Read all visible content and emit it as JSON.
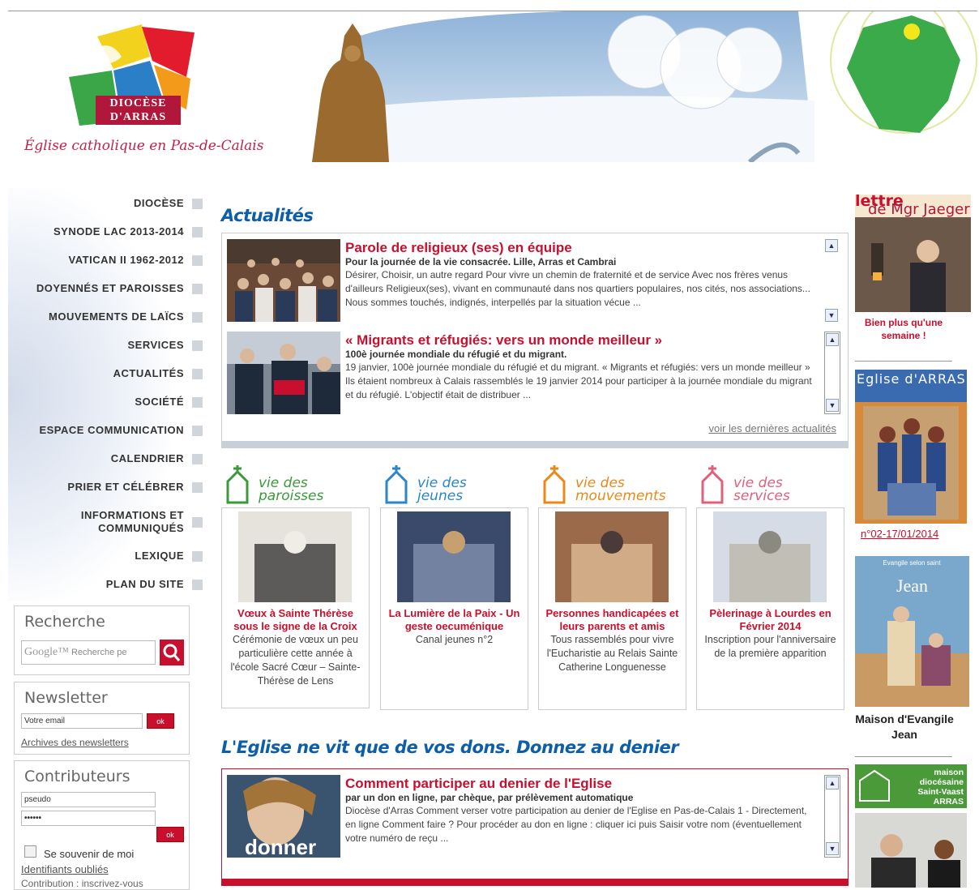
{
  "header": {
    "logo_line1": "DIOCÈSE",
    "logo_line2": "D'ARRAS",
    "tagline": "Église catholique en Pas-de-Calais"
  },
  "nav": [
    {
      "label": "DIOCÈSE"
    },
    {
      "label": "SYNODE LAC 2013-2014"
    },
    {
      "label": "VATICAN II 1962-2012"
    },
    {
      "label": "DOYENNÉS ET PAROISSES"
    },
    {
      "label": "MOUVEMENTS DE LAÏCS"
    },
    {
      "label": "SERVICES"
    },
    {
      "label": "ACTUALITÉS"
    },
    {
      "label": "SOCIÉTÉ"
    },
    {
      "label": "ESPACE COMMUNICATION"
    },
    {
      "label": "CALENDRIER"
    },
    {
      "label": "PRIER ET CÉLÉBRER"
    },
    {
      "label": "INFORMATIONS ET COMMUNIQUÉS"
    },
    {
      "label": "LEXIQUE"
    },
    {
      "label": "PLAN DU SITE"
    }
  ],
  "search": {
    "title": "Recherche",
    "placeholder": "Recherche pe",
    "google": "Google™"
  },
  "newsletter": {
    "title": "Newsletter",
    "email_value": "Votre email",
    "ok": "ok",
    "archives": "Archives des newsletters"
  },
  "contrib": {
    "title": "Contributeurs",
    "pseudo_value": "pseudo",
    "password_value": "••••••",
    "ok": "ok",
    "remember": "Se souvenir de moi",
    "forgot": "Identifiants oubliés",
    "signup": "Contribution : inscrivez-vous"
  },
  "actualites": {
    "title": "Actualités",
    "articles": [
      {
        "title": "Parole de religieux (ses) en équipe",
        "subtitle": "Pour la journée de la vie consacrée. Lille, Arras et Cambrai",
        "body": "Désirer, Choisir, un autre regard Pour vivre un chemin de fraternité et de service Avec nos frères venus d'ailleurs   Religieux(ses), vivant en communauté dans nos quartiers populaires, nos cités, nos associations... Nous sommes touchés, indignés, interpellés par la situation vécue ..."
      },
      {
        "title": "« Migrants et réfugiés: vers un monde meilleur »",
        "subtitle": "100è journée mondiale du réfugié et du migrant.",
        "body": "19 janvier, 100è journée mondiale du réfugié et du migrant. « Migrants et réfugiés: vers un monde meilleur »      Ils étaient nombreux à Calais rassemblés le 19 janvier 2014 pour participer à la journée mondiale du migrant et du réfugié. L'objectif était de distribuer ..."
      }
    ],
    "more": "voir les dernières actualités"
  },
  "vie": [
    {
      "head1": "vie des",
      "head2": "paroisses",
      "color": "#3a9a3a",
      "title": "Vœux à Sainte Thérèse sous le signe de la Croix",
      "body": "Cérémonie de vœux un peu particulière cette année à l'école Sacré Cœur – Sainte-Thérèse de Lens"
    },
    {
      "head1": "vie des",
      "head2": "jeunes",
      "color": "#2a86c8",
      "title": "La Lumière de la Paix - Un geste oecuménique",
      "body": "Canal jeunes n°2"
    },
    {
      "head1": "vie des",
      "head2": "mouvements",
      "color": "#e88a1a",
      "title": "Personnes handicapées et leurs parents et amis",
      "body": "Tous rassemblés pour vivre l'Eucharistie au Relais Sainte Catherine Longuenesse"
    },
    {
      "head1": "vie des",
      "head2": "services",
      "color": "#e0607a",
      "title": "Pèlerinage à Lourdes en Février 2014",
      "body": "Inscription pour l'anniversaire de la première apparition"
    }
  ],
  "denier": {
    "title": "L'Eglise ne vit que de vos dons. Donnez au denier",
    "article": {
      "title": "Comment participer au denier de l'Eglise",
      "subtitle": "par un don en ligne, par chèque, par prélèvement automatique",
      "body": "  Diocèse d'Arras Comment verser votre participation au denier de l'Eglise en Pas-de-Calais  1 - Directement, en ligne      Comment faire ?        Pour procéder au don en ligne :  cliquer ici puis    Saisir votre nom (éventuellement votre numéro de reçu ...",
      "img_text": "donner"
    }
  },
  "right": {
    "lettre_a": "lettre",
    "lettre_b": "de Mgr Jaeger",
    "lettre_caption": "Bien plus qu'une semaine !",
    "mag_title": "Eglise d'ARRAS",
    "mag_issue": "n°02-17/01/2014",
    "jean_top": "Evangile selon saint",
    "jean_name": "Jean",
    "jean_caption": "Maison d'Evangile Jean",
    "maison": "maison diocésaine Saint-Vaast ARRAS"
  }
}
